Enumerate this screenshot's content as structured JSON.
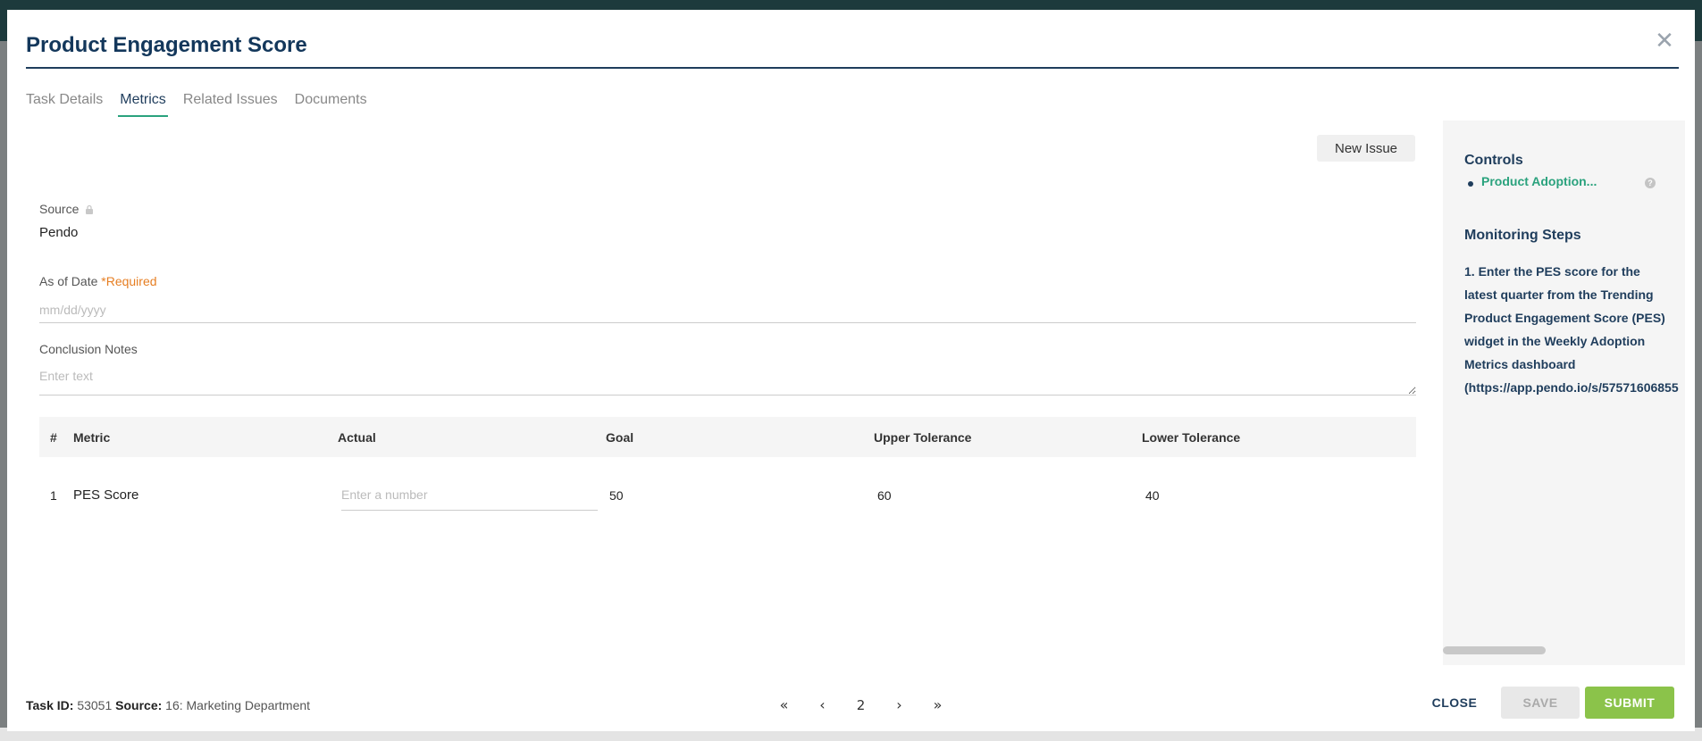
{
  "modal": {
    "title": "Product Engagement Score",
    "close_icon": "close-icon"
  },
  "tabs": [
    {
      "label": "Task Details",
      "active": false
    },
    {
      "label": "Metrics",
      "active": true
    },
    {
      "label": "Related Issues",
      "active": false
    },
    {
      "label": "Documents",
      "active": false
    }
  ],
  "toolbar": {
    "new_issue_label": "New Issue"
  },
  "form": {
    "source_label": "Source",
    "source_value": "Pendo",
    "date_label": "As of Date",
    "date_required": "*Required",
    "date_placeholder": "mm/dd/yyyy",
    "notes_label": "Conclusion Notes",
    "notes_placeholder": "Enter text"
  },
  "table": {
    "headers": [
      "#",
      "Metric",
      "Actual",
      "Goal",
      "Upper Tolerance",
      "Lower Tolerance"
    ],
    "rows": [
      {
        "index": "1",
        "metric": "PES Score",
        "actual_placeholder": "Enter a number",
        "goal": "50",
        "upper": "60",
        "lower": "40"
      }
    ]
  },
  "side": {
    "controls_heading": "Controls",
    "controls": [
      {
        "label": "Product Adoption..."
      }
    ],
    "monitoring_heading": "Monitoring Steps",
    "monitoring_text": "1. Enter the PES score for the\nlatest quarter from the Trending\nProduct Engagement Score (PES)\nwidget in the Weekly Adoption\nMetrics dashboard\n(https://app.pendo.io/s/57571606855"
  },
  "footer": {
    "task_id_label": "Task ID:",
    "task_id_value": "53051",
    "source_label": "Source:",
    "source_value": "16: Marketing Department",
    "page_number": "2",
    "close_label": "CLOSE",
    "save_label": "SAVE",
    "submit_label": "SUBMIT"
  },
  "colors": {
    "title": "#13375b",
    "accent_green": "#2aa27d",
    "required": "#e67e22",
    "submit": "#8bc34a"
  }
}
